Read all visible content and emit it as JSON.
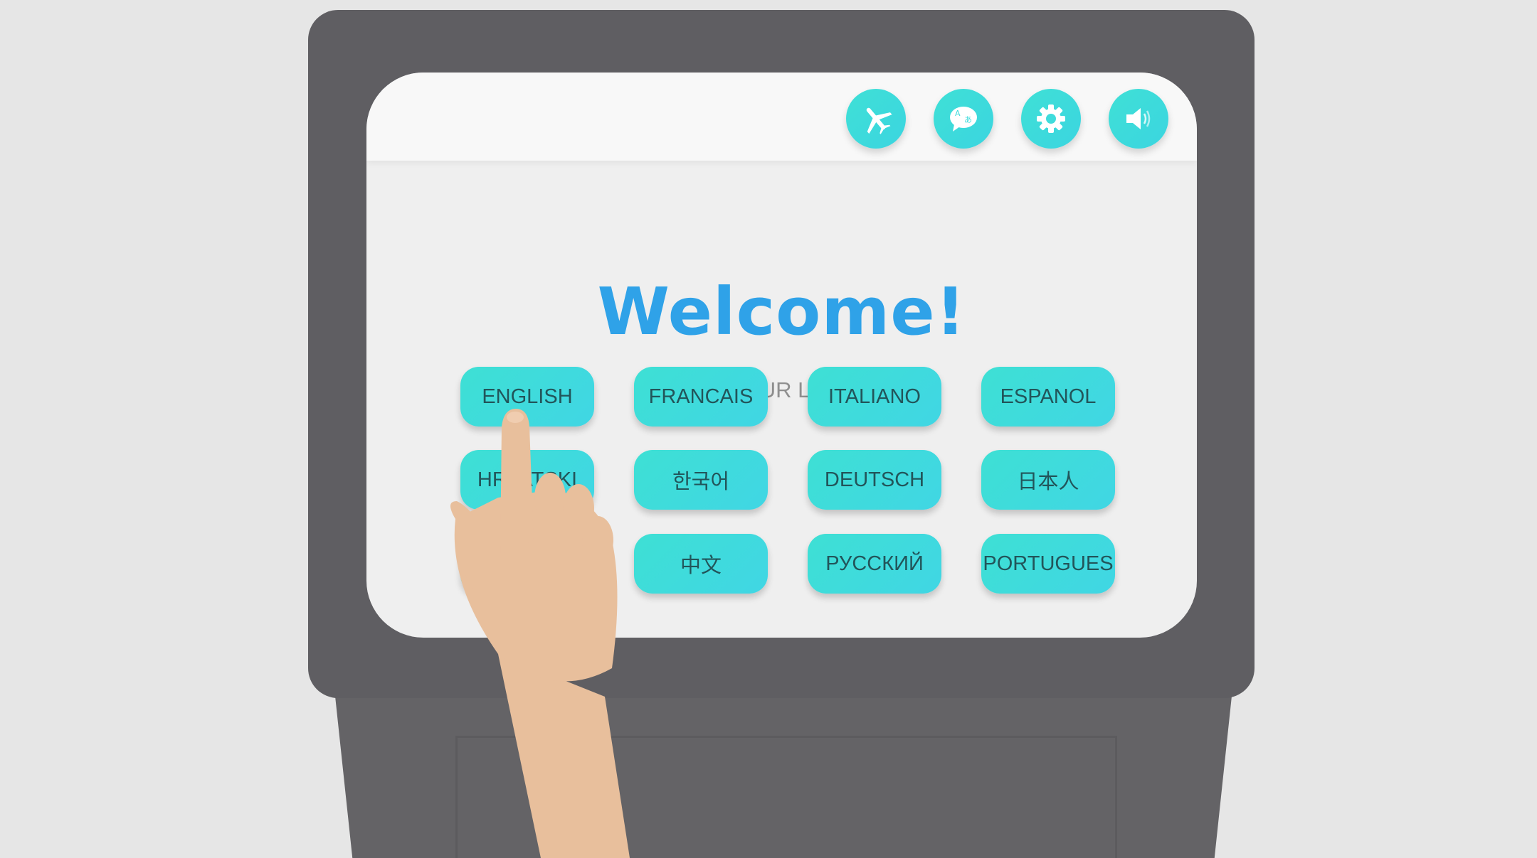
{
  "topbar": {
    "icons": [
      {
        "name": "airplane-icon"
      },
      {
        "name": "translate-icon",
        "glyph_a": "A",
        "glyph_b": "あ"
      },
      {
        "name": "gear-icon"
      },
      {
        "name": "speaker-icon"
      }
    ]
  },
  "main": {
    "title": "Welcome!",
    "subtitle": "SELECT YOUR LANGUAGE:"
  },
  "languages": [
    {
      "label": "ENGLISH"
    },
    {
      "label": "FRANCAIS"
    },
    {
      "label": "ITALIANO"
    },
    {
      "label": "ESPANOL"
    },
    {
      "label": "HRVATSKI"
    },
    {
      "label": "한국어"
    },
    {
      "label": "DEUTSCH"
    },
    {
      "label": "日本人"
    },
    {
      "label": ""
    },
    {
      "label": "中文"
    },
    {
      "label": "РУССКИЙ"
    },
    {
      "label": "PORTUGUES"
    }
  ],
  "colors": {
    "accent": "#3fdcdc",
    "title": "#2fa2e8",
    "bezel": "#5f5e62",
    "background": "#e6e6e6",
    "skin": "#e8bf9c"
  }
}
